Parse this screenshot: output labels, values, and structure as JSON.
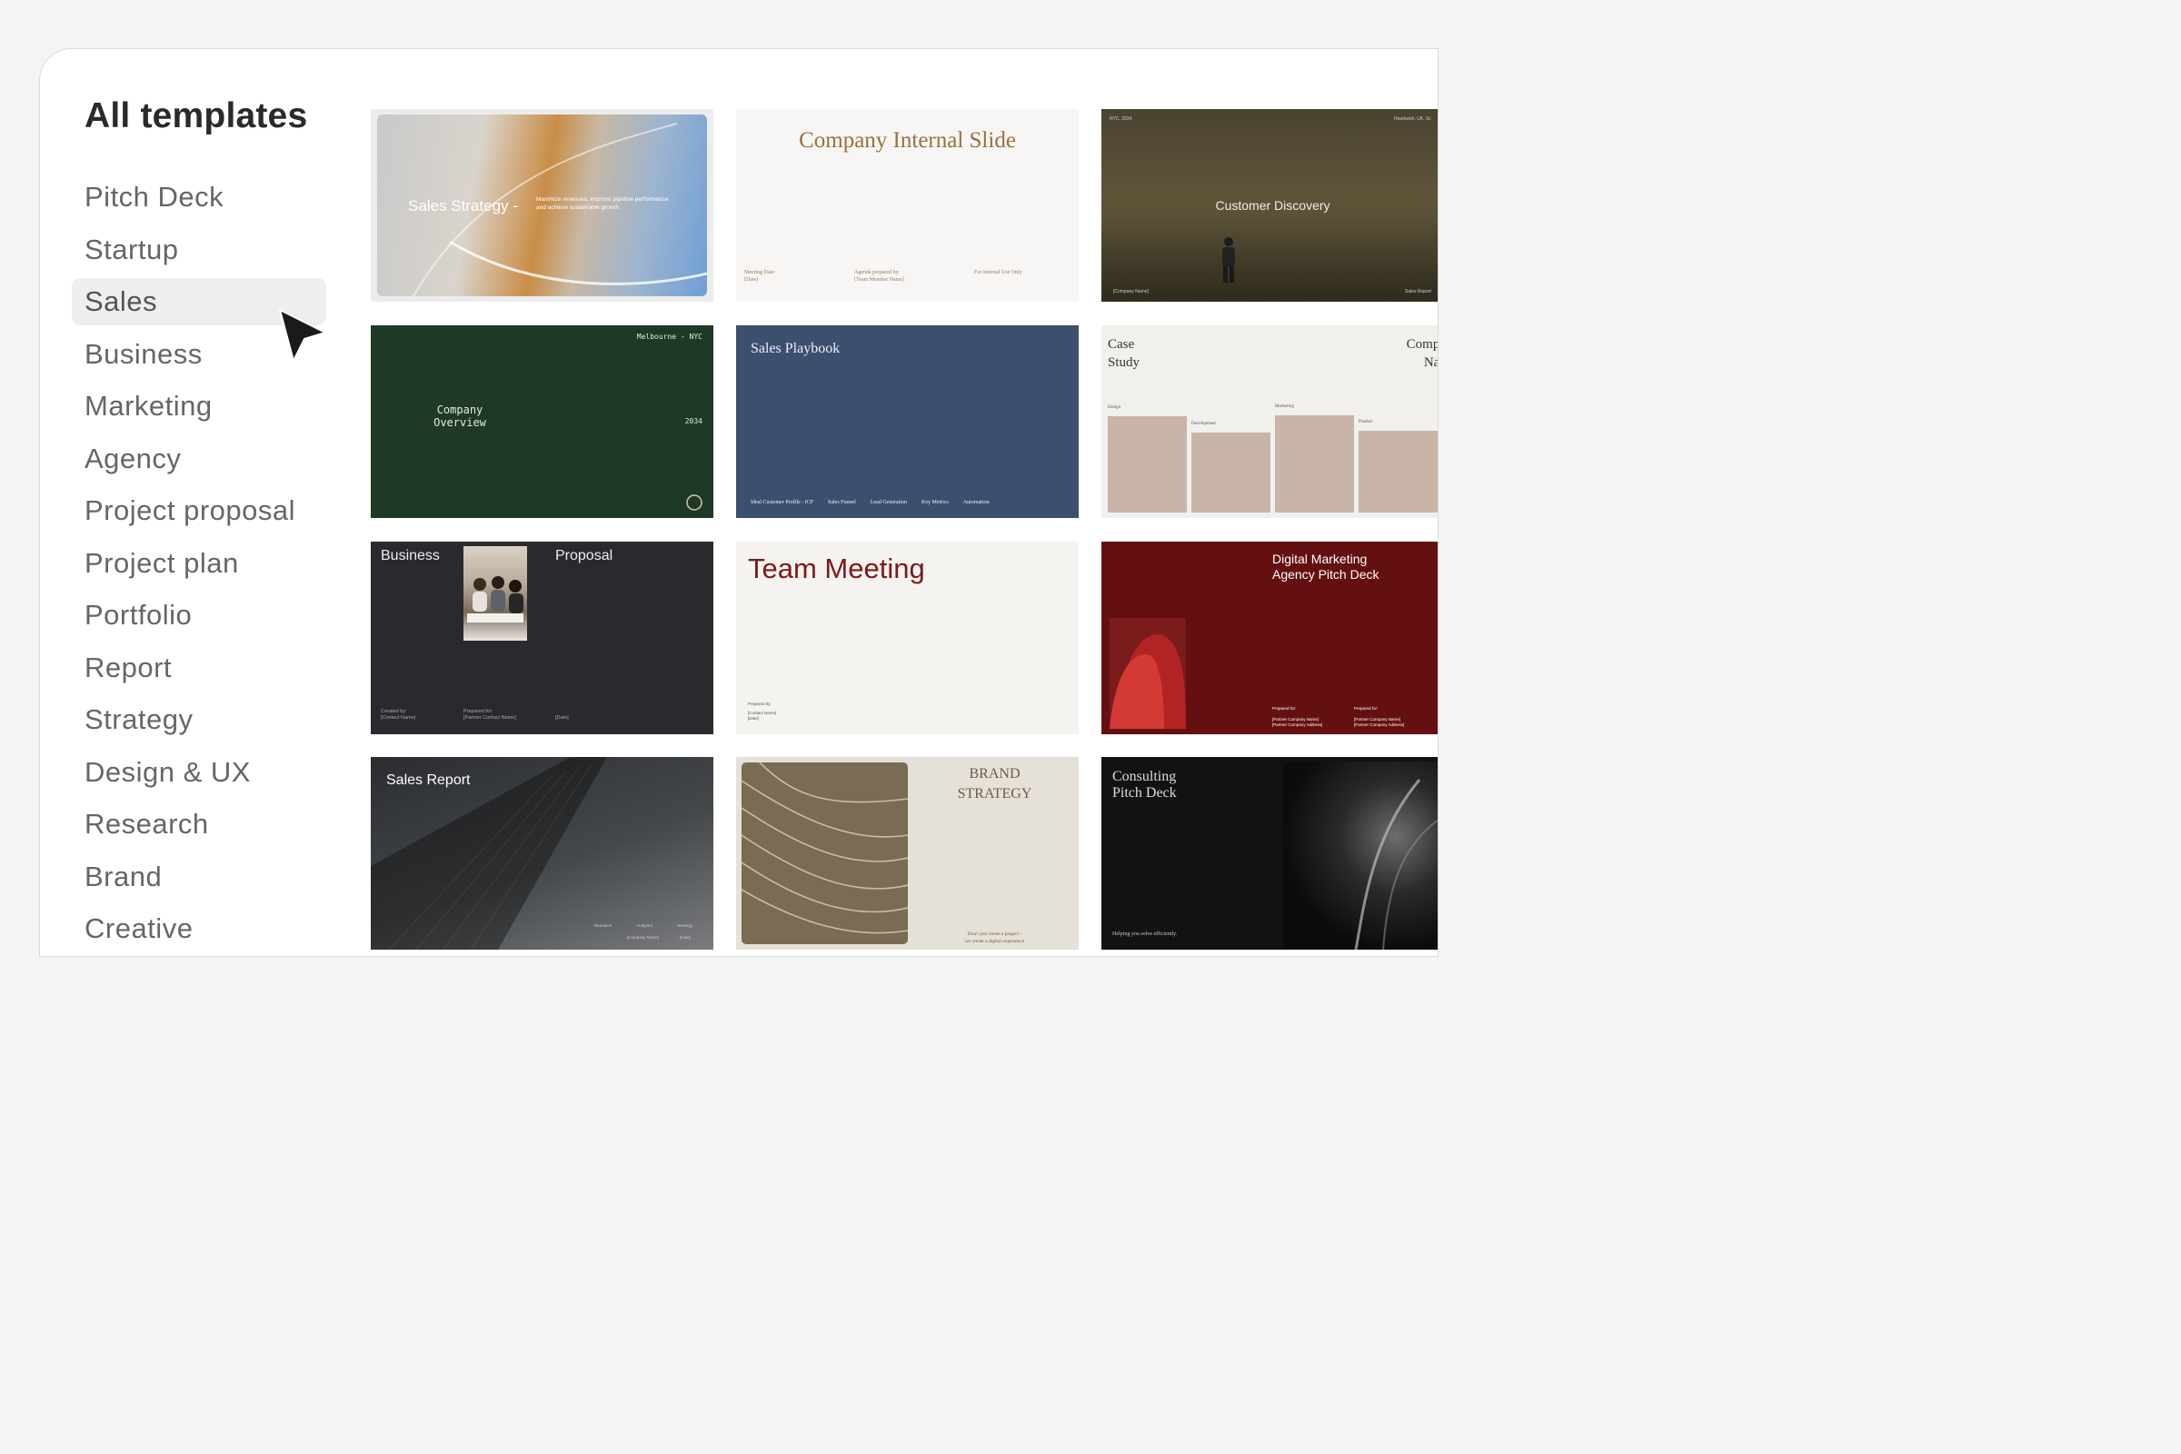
{
  "sidebar": {
    "title": "All templates",
    "items": [
      {
        "label": "Pitch Deck"
      },
      {
        "label": "Startup"
      },
      {
        "label": "Sales",
        "active": true
      },
      {
        "label": "Business"
      },
      {
        "label": "Marketing"
      },
      {
        "label": "Agency"
      },
      {
        "label": "Project proposal"
      },
      {
        "label": "Project plan"
      },
      {
        "label": "Portfolio"
      },
      {
        "label": "Report"
      },
      {
        "label": "Strategy"
      },
      {
        "label": "Design & UX"
      },
      {
        "label": "Research"
      },
      {
        "label": "Brand"
      },
      {
        "label": "Creative"
      }
    ]
  },
  "templates": {
    "sales_strategy": {
      "title": "Sales Strategy  -",
      "subtitle": "Maximize revenues, improve pipeline performance and achieve sustainable growth"
    },
    "company_internal": {
      "title": "Company Internal Slide",
      "meeting_label": "Meeting Date:",
      "meeting_value": "[Date]",
      "agenda_label": "Agenda prepared by:",
      "agenda_value": "[Team Member Name]",
      "internal": "For Internal Use Only"
    },
    "customer_discovery": {
      "title": "Customer Discovery",
      "top_left": "NYC, 2034",
      "top_right": "Headwork, UK, Sc",
      "bottom_left": "[Company Name]",
      "bottom_right": "Sales Report"
    },
    "company_overview": {
      "location": "Melbourne - NYC",
      "title_line1": "Company",
      "title_line2": "Overview",
      "year": "2034"
    },
    "sales_playbook": {
      "title": "Sales Playbook",
      "footer": [
        "Ideal Customer Profile - ICP",
        "Sales Funnel",
        "Lead Generation",
        "Key Metrics",
        "Automation"
      ]
    },
    "case_study": {
      "title_line1": "Case",
      "title_line2": "Study",
      "company_line1": "Compar",
      "company_line2": "Nam",
      "bar_labels": [
        "Design",
        "Development",
        "Marketing",
        "Product"
      ]
    },
    "business_proposal": {
      "title_left": "Business",
      "title_right": "Proposal",
      "created_label": "Created by:",
      "created_value": "[Contact Name]",
      "prepared_label": "Prepared for:",
      "prepared_value": "[Partner Contact Name]",
      "date": "[Date]"
    },
    "team_meeting": {
      "title": "Team Meeting",
      "prepared_label": "Prepared by:",
      "contact": "[Contact Name]",
      "date": "[Date]"
    },
    "digital_marketing": {
      "title_line1": "Digital Marketing",
      "title_line2": "Agency Pitch Deck",
      "prepared_label_1": "Prepared for:",
      "company_name_1": "[Partner Company Name]",
      "company_address_1": "[Partner Company Address]",
      "prepared_label_2": "Prepared for:",
      "company_name_2": "[Partner Company Name]",
      "company_address_2": "[Partner Company Address]"
    },
    "sales_report": {
      "title": "Sales Report",
      "labels": [
        "Research",
        "Analytics",
        "Strategy"
      ],
      "company": "[Company Name]",
      "date": "[Date]"
    },
    "brand_strategy": {
      "title_line1": "BRAND",
      "title_line2": "STRATEGY",
      "tagline_line1": "Don't just create a project -",
      "tagline_line2": "we create a digital experience"
    },
    "consulting": {
      "title_line1": "Consulting",
      "title_line2": "Pitch Deck",
      "footer": "Helping you solve efficiently."
    }
  }
}
